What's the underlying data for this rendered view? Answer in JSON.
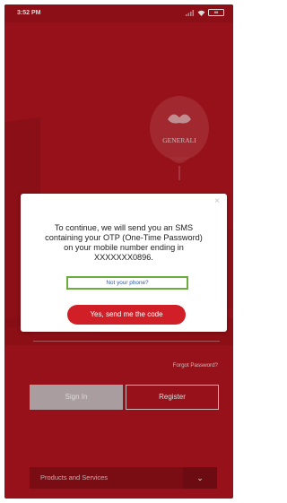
{
  "status_bar": {
    "time": "3:52 PM",
    "battery_label": "88"
  },
  "brand": {
    "logo_text": "GENERALI"
  },
  "dialog": {
    "close_icon": "close-icon",
    "message_lines": [
      "To continue, we will send you an SMS",
      "containing your OTP (One-Time Password)",
      "on your mobile number ending in",
      "XXXXXXX0896."
    ],
    "not_your_phone_label": "Not your phone?",
    "send_code_label": "Yes, send me the code"
  },
  "login": {
    "forgot_password_label": "Forgot Password?",
    "sign_in_label": "Sign In",
    "register_label": "Register"
  },
  "footer": {
    "products_label": "Products and Services",
    "chevron_icon": "chevron-down-icon"
  },
  "colors": {
    "brand_red": "#b1151e",
    "button_red": "#d01f26",
    "highlight_green": "#6cab3e",
    "link_blue": "#2a5bb0"
  }
}
